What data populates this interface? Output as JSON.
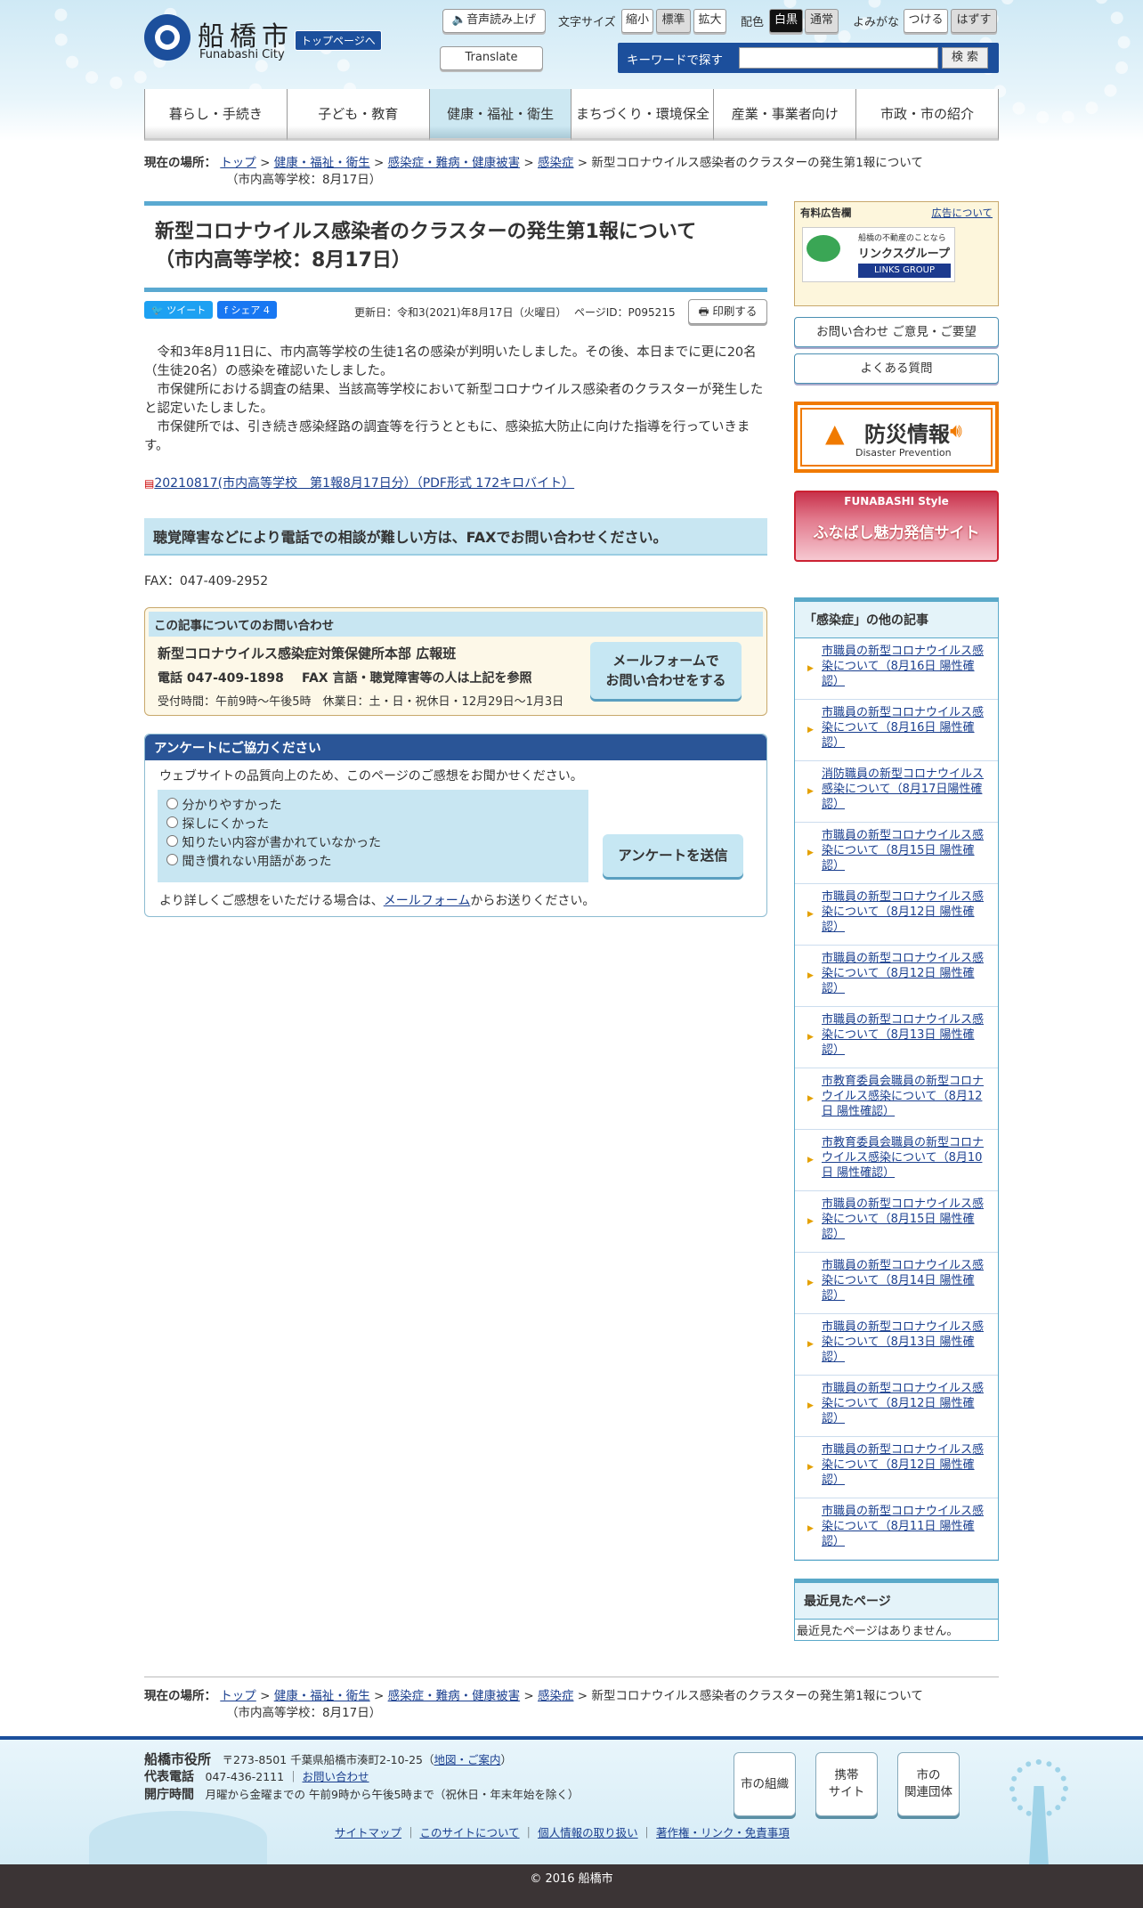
{
  "header": {
    "city_name": "船橋市",
    "city_en": "Funabashi City",
    "top_link": "トップページへ",
    "voice": "音声読み上げ",
    "font_size_label": "文字サイズ",
    "font_small": "縮小",
    "font_std": "標準",
    "font_large": "拡大",
    "color_label": "配色",
    "color_bw": "白黒",
    "color_normal": "通常",
    "ruby_label": "よみがな",
    "ruby_on": "つける",
    "ruby_off": "はずす",
    "translate": "Translate",
    "search_label": "キーワードで探す",
    "search_btn": "検 索"
  },
  "nav": [
    "暮らし・手続き",
    "子ども・教育",
    "健康・福祉・衛生",
    "まちづくり・環境保全",
    "産業・事業者向け",
    "市政・市の紹介"
  ],
  "breadcrumb": {
    "label": "現在の場所：",
    "items": [
      "トップ",
      "健康・福祉・衛生",
      "感染症・難病・健康被害",
      "感染症"
    ],
    "current": "新型コロナウイルス感染者のクラスターの発生第1報について",
    "current2": "（市内高等学校：8月17日）"
  },
  "article": {
    "title1": "新型コロナウイルス感染者のクラスターの発生第1報について",
    "title2": "（市内高等学校：8月17日）",
    "tweet": "ツイート",
    "share": "シェア 4",
    "updated": "更新日：令和3(2021)年8月17日（火曜日）",
    "page_id": "ページID：P095215",
    "print": "印刷する",
    "p1": "令和3年8月11日に、市内高等学校の生徒1名の感染が判明いたしました。その後、本日までに更に20名（生徒20名）の感染を確認いたしました。",
    "p2": "市保健所における調査の結果、当該高等学校において新型コロナウイルス感染者のクラスターが発生したと認定いたしました。",
    "p3": "市保健所では、引き続き感染経路の調査等を行うとともに、感染拡大防止に向けた指導を行っていきます。",
    "pdf_link": "20210817(市内高等学校　第1報8月17日分）（PDF形式 172キロバイト）",
    "fax_heading": "聴覚障害などにより電話での相談が難しい方は、FAXでお問い合わせください。",
    "fax": "FAX：047-409-2952"
  },
  "contact": {
    "heading": "この記事についてのお問い合わせ",
    "dept": "新型コロナウイルス感染症対策保健所本部 広報班",
    "phone": "電話 047-409-1898",
    "fax": "FAX 言語・聴覚障害等の人は上記を参照",
    "hours": "受付時間：午前9時～午後5時　休業日：土・日・祝休日・12月29日～1月3日",
    "mail_btn_1": "メールフォームで",
    "mail_btn_2": "お問い合わせをする"
  },
  "survey": {
    "heading": "アンケートにご協力ください",
    "intro": "ウェブサイトの品質向上のため、このページのご感想をお聞かせください。",
    "options": [
      "分かりやすかった",
      "探しにくかった",
      "知りたい内容が書かれていなかった",
      "聞き慣れない用語があった"
    ],
    "submit": "アンケートを送信",
    "footer_pre": "より詳しくご感想をいただける場合は、",
    "footer_link": "メールフォーム",
    "footer_post": "からお送りください。"
  },
  "sidebar": {
    "ad_label": "有料広告欄",
    "ad_link": "広告について",
    "ad_text_small": "船橋の不動産のことなら",
    "ad_text": "リンクスグループ",
    "ad_sub": "LINKS GROUP",
    "contact_btn": "お問い合わせ ご意見・ご要望",
    "faq_btn": "よくある質問",
    "disaster": "防災情報",
    "disaster_en": "Disaster Prevention",
    "style_top": "FUNABASHI Style",
    "style_text": "ふなばし魅力発信サイト",
    "other_heading": "「感染症」の他の記事",
    "other_items": [
      "市職員の新型コロナウイルス感染について（8月16日 陽性確認）",
      "市職員の新型コロナウイルス感染について（8月16日 陽性確認）",
      "消防職員の新型コロナウイルス感染について（8月17日陽性確認）",
      "市職員の新型コロナウイルス感染について（8月15日 陽性確認）",
      "市職員の新型コロナウイルス感染について（8月12日 陽性確認）",
      "市職員の新型コロナウイルス感染について（8月12日 陽性確認）",
      "市職員の新型コロナウイルス感染について（8月13日 陽性確認）",
      "市教育委員会職員の新型コロナウイルス感染について（8月12日 陽性確認）",
      "市教育委員会職員の新型コロナウイルス感染について（8月10日 陽性確認）",
      "市職員の新型コロナウイルス感染について（8月15日 陽性確認）",
      "市職員の新型コロナウイルス感染について（8月14日 陽性確認）",
      "市職員の新型コロナウイルス感染について（8月13日 陽性確認）",
      "市職員の新型コロナウイルス感染について（8月12日 陽性確認）",
      "市職員の新型コロナウイルス感染について（8月12日 陽性確認）",
      "市職員の新型コロナウイルス感染について（8月11日 陽性確認）"
    ],
    "recent_heading": "最近見たページ",
    "recent_empty": "最近見たページはありません。"
  },
  "footer": {
    "office": "船橋市役所",
    "address": "〒273-8501 千葉県船橋市湊町2-10-25（",
    "map_link": "地図・ご案内",
    "address_end": "）",
    "tel_label": "代表電話",
    "tel": "047-436-2111",
    "contact_link": "お問い合わせ",
    "hours_label": "開庁時間",
    "hours": "月曜から金曜までの 午前9時から午後5時まで（祝休日・年末年始を除く）",
    "btn_org": "市の組織",
    "btn_mobile_1": "携帯",
    "btn_mobile_2": "サイト",
    "btn_related_1": "市の",
    "btn_related_2": "関連団体",
    "links": [
      "サイトマップ",
      "このサイトについて",
      "個人情報の取り扱い",
      "著作権・リンク・免責事項"
    ],
    "copyright": "© 2016 船橋市"
  }
}
